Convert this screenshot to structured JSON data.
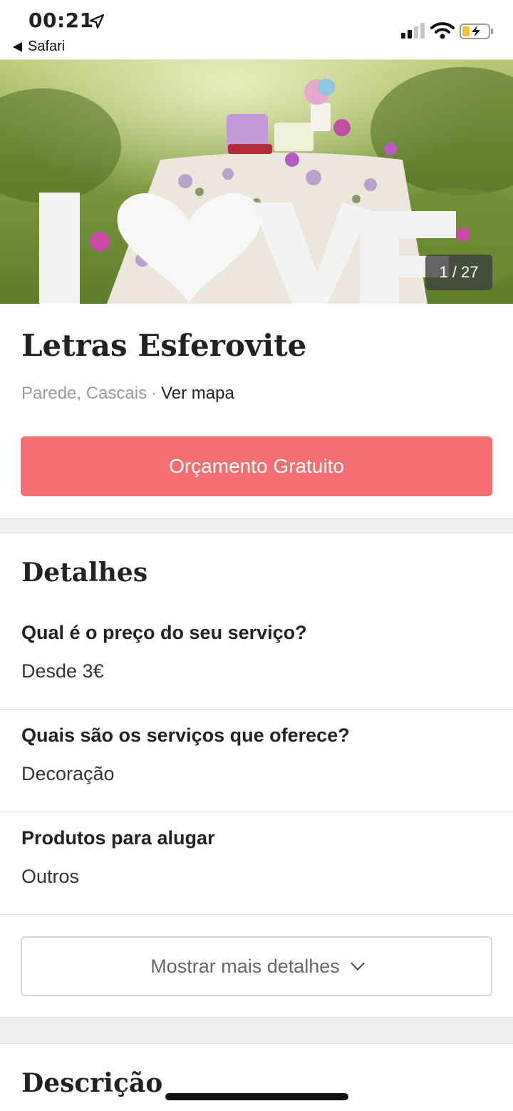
{
  "status_bar": {
    "time": "00:21",
    "back_label": "Safari",
    "icons": [
      "location-arrow-icon",
      "cellular-signal-icon",
      "wifi-icon",
      "battery-charging-icon"
    ]
  },
  "gallery": {
    "counter": "1 / 27",
    "current": 1,
    "total": 27
  },
  "listing": {
    "title": "Letras Esferovite",
    "location": "Parede, Cascais",
    "separator": "·",
    "map_link": "Ver mapa",
    "cta_label": "Orçamento Gratuito"
  },
  "details": {
    "title": "Detalhes",
    "items": [
      {
        "question": "Qual é o preço do seu serviço?",
        "answer": "Desde 3€"
      },
      {
        "question": "Quais são os serviços que oferece?",
        "answer": "Decoração"
      },
      {
        "question": "Produtos para alugar",
        "answer": "Outros"
      }
    ],
    "more_label": "Mostrar mais detalhes"
  },
  "description": {
    "title": "Descrição"
  },
  "colors": {
    "accent": "#f56f72",
    "divider": "#dedede",
    "section_gap": "#efefef"
  }
}
